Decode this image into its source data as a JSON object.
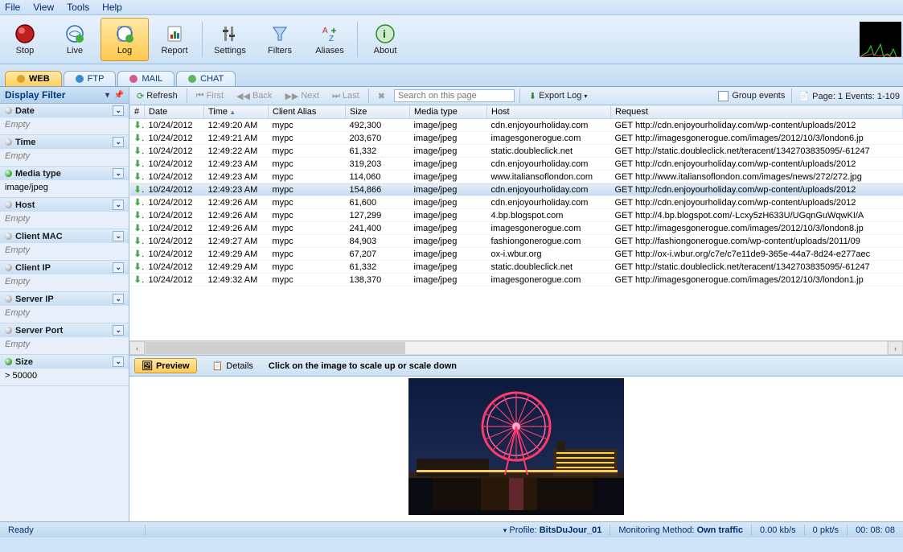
{
  "menu": {
    "file": "File",
    "view": "View",
    "tools": "Tools",
    "help": "Help"
  },
  "toolbar": [
    {
      "key": "stop",
      "label": "Stop"
    },
    {
      "key": "live",
      "label": "Live"
    },
    {
      "key": "log",
      "label": "Log",
      "active": true
    },
    {
      "key": "report",
      "label": "Report"
    },
    {
      "key": "sep"
    },
    {
      "key": "settings",
      "label": "Settings"
    },
    {
      "key": "filters",
      "label": "Filters"
    },
    {
      "key": "aliases",
      "label": "Aliases"
    },
    {
      "key": "sep"
    },
    {
      "key": "about",
      "label": "About"
    }
  ],
  "tabs": [
    {
      "key": "web",
      "label": "WEB",
      "active": true
    },
    {
      "key": "ftp",
      "label": "FTP"
    },
    {
      "key": "mail",
      "label": "MAIL"
    },
    {
      "key": "chat",
      "label": "CHAT"
    }
  ],
  "left": {
    "title": "Display Filter",
    "sections": [
      {
        "key": "date",
        "label": "Date",
        "value": "Empty",
        "green": false
      },
      {
        "key": "time",
        "label": "Time",
        "value": "Empty",
        "green": false
      },
      {
        "key": "media",
        "label": "Media type",
        "value": "image/jpeg",
        "green": true
      },
      {
        "key": "host",
        "label": "Host",
        "value": "Empty",
        "green": false
      },
      {
        "key": "clientmac",
        "label": "Client MAC",
        "value": "Empty",
        "green": false
      },
      {
        "key": "clientip",
        "label": "Client IP",
        "value": "Empty",
        "green": false
      },
      {
        "key": "serverip",
        "label": "Server IP",
        "value": "Empty",
        "green": false
      },
      {
        "key": "serverport",
        "label": "Server Port",
        "value": "Empty",
        "green": false
      },
      {
        "key": "size",
        "label": "Size",
        "value": "> 50000",
        "green": true
      }
    ]
  },
  "gridbar": {
    "refresh": "Refresh",
    "first": "First",
    "back": "Back",
    "next": "Next",
    "last": "Last",
    "search_ph": "Search on this page",
    "export": "Export Log",
    "group": "Group events",
    "pageinfo": "Page: 1 Events: 1-109"
  },
  "columns": [
    "#",
    "Date",
    "Time",
    "Client Alias",
    "Size",
    "Media type",
    "Host",
    "Request"
  ],
  "rows": [
    {
      "date": "10/24/2012",
      "time": "12:49:20 AM",
      "alias": "mypc",
      "size": "492,300",
      "media": "image/jpeg",
      "host": "cdn.enjoyourholiday.com",
      "req": "GET http://cdn.enjoyourholiday.com/wp-content/uploads/2012"
    },
    {
      "date": "10/24/2012",
      "time": "12:49:21 AM",
      "alias": "mypc",
      "size": "203,670",
      "media": "image/jpeg",
      "host": "imagesgonerogue.com",
      "req": "GET http://imagesgonerogue.com/images/2012/10/3/london6.jp"
    },
    {
      "date": "10/24/2012",
      "time": "12:49:22 AM",
      "alias": "mypc",
      "size": "61,332",
      "media": "image/jpeg",
      "host": "static.doubleclick.net",
      "req": "GET http://static.doubleclick.net/teracent/1342703835095/-61247"
    },
    {
      "date": "10/24/2012",
      "time": "12:49:23 AM",
      "alias": "mypc",
      "size": "319,203",
      "media": "image/jpeg",
      "host": "cdn.enjoyourholiday.com",
      "req": "GET http://cdn.enjoyourholiday.com/wp-content/uploads/2012"
    },
    {
      "date": "10/24/2012",
      "time": "12:49:23 AM",
      "alias": "mypc",
      "size": "114,060",
      "media": "image/jpeg",
      "host": "www.italiansoflondon.com",
      "req": "GET http://www.italiansoflondon.com/images/news/272/272.jpg"
    },
    {
      "date": "10/24/2012",
      "time": "12:49:23 AM",
      "alias": "mypc",
      "size": "154,866",
      "media": "image/jpeg",
      "host": "cdn.enjoyourholiday.com",
      "req": "GET http://cdn.enjoyourholiday.com/wp-content/uploads/2012",
      "sel": true
    },
    {
      "date": "10/24/2012",
      "time": "12:49:26 AM",
      "alias": "mypc",
      "size": "61,600",
      "media": "image/jpeg",
      "host": "cdn.enjoyourholiday.com",
      "req": "GET http://cdn.enjoyourholiday.com/wp-content/uploads/2012"
    },
    {
      "date": "10/24/2012",
      "time": "12:49:26 AM",
      "alias": "mypc",
      "size": "127,299",
      "media": "image/jpeg",
      "host": "4.bp.blogspot.com",
      "req": "GET http://4.bp.blogspot.com/-Lcxy5zH633U/UGqnGuWqwKI/A"
    },
    {
      "date": "10/24/2012",
      "time": "12:49:26 AM",
      "alias": "mypc",
      "size": "241,400",
      "media": "image/jpeg",
      "host": "imagesgonerogue.com",
      "req": "GET http://imagesgonerogue.com/images/2012/10/3/london8.jp"
    },
    {
      "date": "10/24/2012",
      "time": "12:49:27 AM",
      "alias": "mypc",
      "size": "84,903",
      "media": "image/jpeg",
      "host": "fashiongonerogue.com",
      "req": "GET http://fashiongonerogue.com/wp-content/uploads/2011/09"
    },
    {
      "date": "10/24/2012",
      "time": "12:49:29 AM",
      "alias": "mypc",
      "size": "67,207",
      "media": "image/jpeg",
      "host": "ox-i.wbur.org",
      "req": "GET http://ox-i.wbur.org/c7e/c7e11de9-365e-44a7-8d24-e277aec"
    },
    {
      "date": "10/24/2012",
      "time": "12:49:29 AM",
      "alias": "mypc",
      "size": "61,332",
      "media": "image/jpeg",
      "host": "static.doubleclick.net",
      "req": "GET http://static.doubleclick.net/teracent/1342703835095/-61247"
    },
    {
      "date": "10/24/2012",
      "time": "12:49:32 AM",
      "alias": "mypc",
      "size": "138,370",
      "media": "image/jpeg",
      "host": "imagesgonerogue.com",
      "req": "GET http://imagesgonerogue.com/images/2012/10/3/london1.jp"
    }
  ],
  "preview": {
    "preview": "Preview",
    "details": "Details",
    "hint": "Click on the image to scale up or scale down"
  },
  "status": {
    "ready": "Ready",
    "profile_l": "Profile:",
    "profile_v": "BitsDuJour_01",
    "mon_l": "Monitoring Method:",
    "mon_v": "Own traffic",
    "rate": "0.00 kb/s",
    "pkt": "0 pkt/s",
    "clock": "00: 08: 08"
  }
}
